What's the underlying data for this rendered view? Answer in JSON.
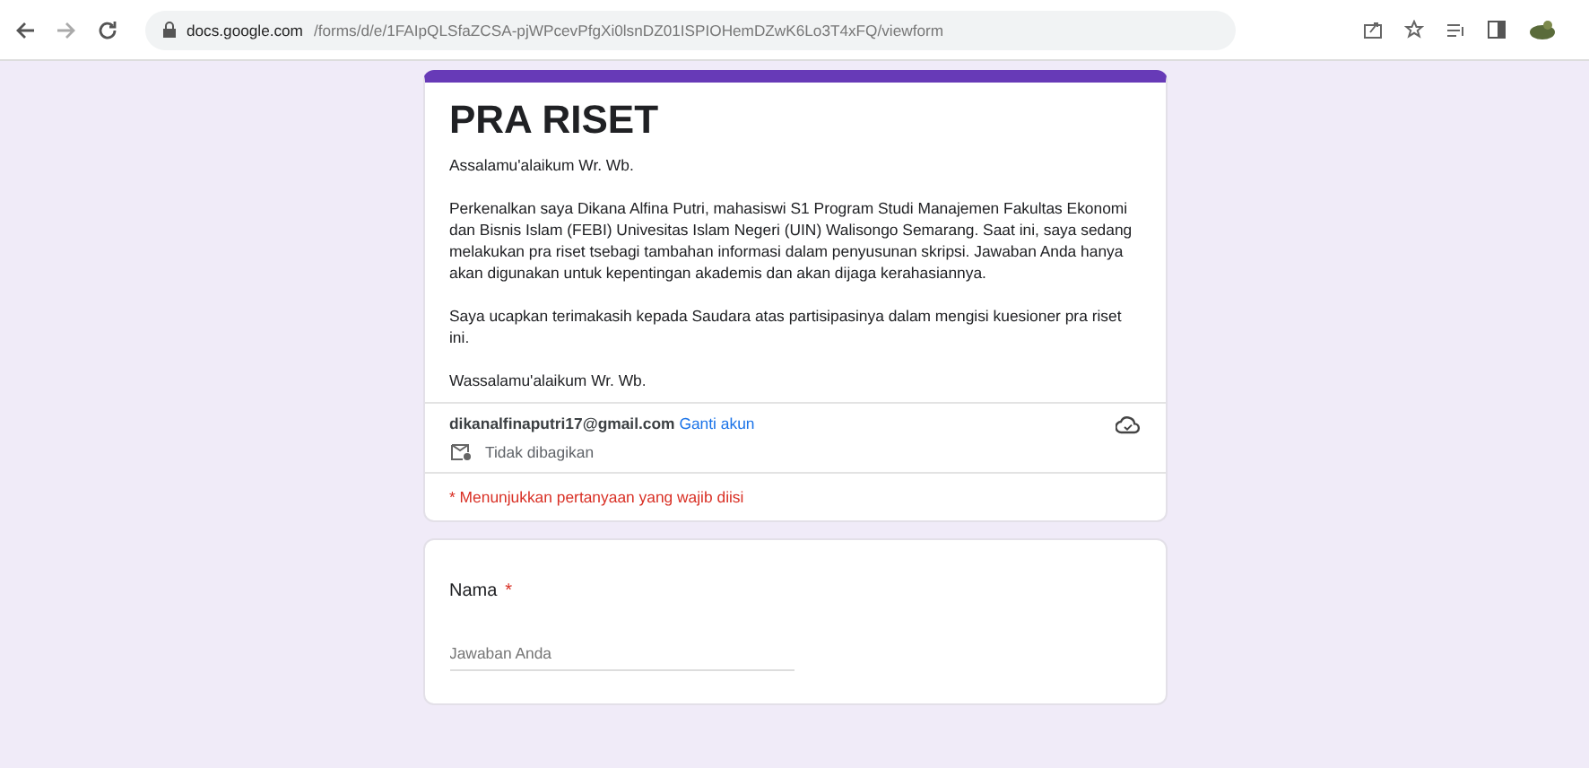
{
  "browser": {
    "url_host": "docs.google.com",
    "url_path": "/forms/d/e/1FAIpQLSfaZCSA-pjWPcevPfgXi0lsnDZ01ISPIOHemDZwK6Lo3T4xFQ/viewform"
  },
  "form": {
    "title": "PRA RISET",
    "description": [
      "Assalamu'alaikum Wr. Wb.",
      "Perkenalkan saya Dikana Alfina Putri, mahasiswi S1 Program Studi Manajemen Fakultas Ekonomi dan Bisnis Islam (FEBI) Univesitas Islam Negeri (UIN) Walisongo Semarang. Saat ini, saya sedang melakukan pra riset tsebagi tambahan informasi dalam penyusunan skripsi. Jawaban Anda hanya akan digunakan untuk kepentingan akademis dan akan dijaga kerahasiannya.",
      "Saya ucapkan terimakasih kepada Saudara atas partisipasinya dalam mengisi kuesioner pra riset ini.",
      "Wassalamu'alaikum Wr. Wb."
    ],
    "account_email": "dikanalfinaputri17@gmail.com",
    "switch_account": "Ganti akun",
    "sharing": "Tidak dibagikan",
    "required_note": "* Menunjukkan pertanyaan yang wajib diisi"
  },
  "questions": [
    {
      "label": "Nama",
      "required_mark": "*",
      "placeholder": "Jawaban Anda"
    }
  ]
}
